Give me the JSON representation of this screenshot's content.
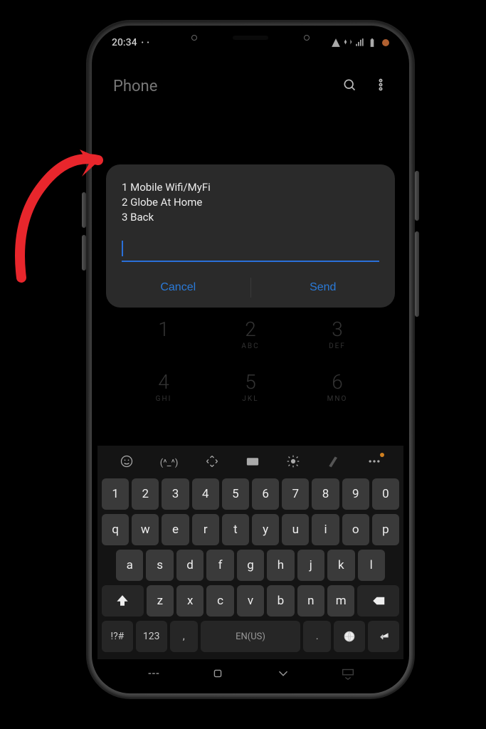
{
  "statusbar": {
    "time": "20:34"
  },
  "header": {
    "title": "Phone"
  },
  "dialog": {
    "line1": "1 Mobile Wifi/MyFi",
    "line2": "2 Globe At Home",
    "line3": "3 Back",
    "cancel": "Cancel",
    "send": "Send"
  },
  "dialpad": {
    "d1": {
      "n": "1",
      "s": ""
    },
    "d2": {
      "n": "2",
      "s": "ABC"
    },
    "d3": {
      "n": "3",
      "s": "DEF"
    },
    "d4": {
      "n": "4",
      "s": "GHI"
    },
    "d5": {
      "n": "5",
      "s": "JKL"
    },
    "d6": {
      "n": "6",
      "s": "MNO"
    }
  },
  "keyboard": {
    "row1": [
      "1",
      "2",
      "3",
      "4",
      "5",
      "6",
      "7",
      "8",
      "9",
      "0"
    ],
    "row2": [
      {
        "k": "q",
        "h": ""
      },
      {
        "k": "w",
        "h": ""
      },
      {
        "k": "e",
        "h": ""
      },
      {
        "k": "r",
        "h": ""
      },
      {
        "k": "t",
        "h": ""
      },
      {
        "k": "y",
        "h": ""
      },
      {
        "k": "u",
        "h": ""
      },
      {
        "k": "i",
        "h": ""
      },
      {
        "k": "o",
        "h": ""
      },
      {
        "k": "p",
        "h": ""
      }
    ],
    "row3": [
      {
        "k": "a",
        "h": ""
      },
      {
        "k": "s",
        "h": ""
      },
      {
        "k": "d",
        "h": ""
      },
      {
        "k": "f",
        "h": ""
      },
      {
        "k": "g",
        "h": ""
      },
      {
        "k": "h",
        "h": ""
      },
      {
        "k": "j",
        "h": ""
      },
      {
        "k": "k",
        "h": ""
      },
      {
        "k": "l",
        "h": ""
      }
    ],
    "row4": [
      {
        "k": "z",
        "h": ""
      },
      {
        "k": "x",
        "h": ""
      },
      {
        "k": "c",
        "h": ""
      },
      {
        "k": "v",
        "h": ""
      },
      {
        "k": "b",
        "h": ""
      },
      {
        "k": "n",
        "h": ""
      },
      {
        "k": "m",
        "h": ""
      }
    ],
    "symKey": "!?#",
    "numKey": "123",
    "spaceLabel": "EN(US)",
    "comma": ",",
    "period": "."
  }
}
